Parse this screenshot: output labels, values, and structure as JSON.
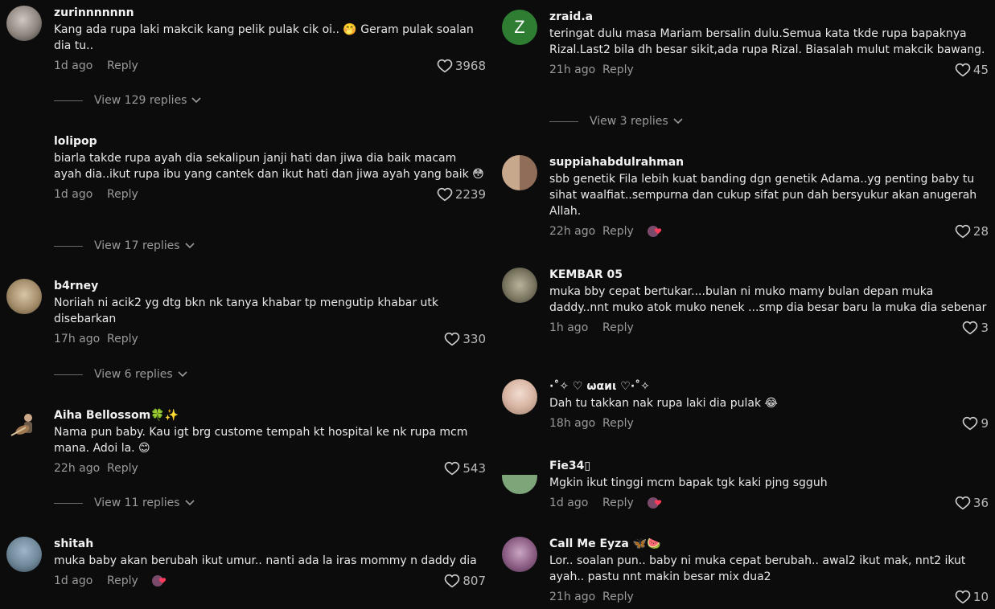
{
  "left": [
    {
      "username": "zurinnnnnnn",
      "text": "Kang ada rupa laki makcik kang pelik pulak cik oi.. 🤭 Geram pulak soalan dia tu..",
      "time": "1d ago",
      "reply": "Reply",
      "likes": "3968",
      "view_replies": "View 129 replies"
    },
    {
      "username": "lolipop",
      "text": "biarla takde rupa ayah dia sekalipun janji hati dan jiwa dia baik macam ayah dia..ikut rupa ibu yang cantek dan ikut hati dan jiwa ayah yang baik 😳",
      "time": "1d ago",
      "reply": "Reply",
      "likes": "2239",
      "view_replies": "View 17 replies"
    },
    {
      "username": "b4rney",
      "text": "Noriiah ni acik2 yg dtg bkn nk tanya khabar tp mengutip khabar utk disebarkan",
      "time": "17h ago",
      "reply": "Reply",
      "likes": "330",
      "view_replies": "View 6 replies"
    },
    {
      "username": "Aiha Bellossom🍀✨",
      "text": "Nama pun baby. Kau igt brg custome tempah kt hospital ke nk rupa mcm mana. Adoi la. 😊",
      "time": "22h ago",
      "reply": "Reply",
      "likes": "543",
      "view_replies": "View 11 replies"
    },
    {
      "username": "shitah",
      "text": "muka baby akan berubah ikut umur.. nanti ada la iras mommy n daddy dia",
      "time": "1d ago",
      "reply": "Reply",
      "likes": "807"
    }
  ],
  "right": [
    {
      "username": "zraid.a",
      "avatar_letter": "Z",
      "text": "teringat dulu masa Mariam bersalin dulu.Semua kata tkde rupa bapaknya Rizal.Last2 bila dh besar sikit,ada rupa Rizal. Biasalah mulut makcik bawang.",
      "time": "21h ago",
      "reply": "Reply",
      "likes": "45",
      "view_replies": "View 3 replies"
    },
    {
      "username": "suppiahabdulrahman",
      "text": "sbb genetik Fila lebih kuat banding dgn genetik Adama..yg penting baby tu sihat waalfiat..sempurna dan cukup sifat pun dah bersyukur akan anugerah Allah.",
      "time": "22h ago",
      "reply": "Reply",
      "likes": "28"
    },
    {
      "username": "KEMBAR 05",
      "text": "muka bby cepat bertukar....bulan ni muko mamy bulan depan muka daddy..nnt muko atok muko nenek ...smp dia besar baru la muka dia sebenar",
      "time": "1h ago",
      "reply": "Reply",
      "likes": "3"
    },
    {
      "username": "·˚✧ ♡ ωαиι ♡·˚✧",
      "text": "Dah tu takkan nak rupa laki dia pulak 😂",
      "time": "18h ago",
      "reply": "Reply",
      "likes": "9"
    },
    {
      "username": "Fie34▯",
      "text": "Mgkin ikut tinggi mcm bapak tgk kaki pjng sgguh",
      "time": "1d ago",
      "reply": "Reply",
      "likes": "36"
    },
    {
      "username": "Call Me Eyza 🦋🍉",
      "text": "Lor.. soalan pun.. baby ni muka cepat berubah.. awal2 ikut mak, nnt2 ikut ayah.. pastu nnt makin besar mix dua2",
      "time": "21h ago",
      "reply": "Reply",
      "likes": "10"
    }
  ],
  "colors": {
    "background": "#0c0c0c",
    "accent_avatar": "#2e7d32",
    "secondary_text": "#9a9a9a"
  }
}
